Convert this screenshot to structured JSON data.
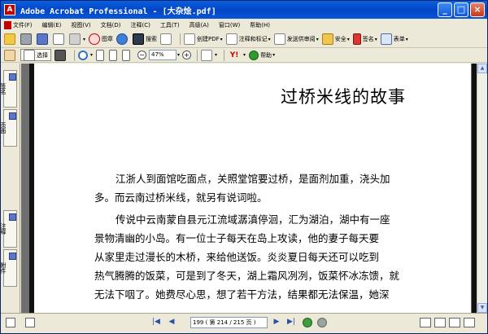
{
  "window": {
    "title": "Adobe Acrobat Professional - [大杂烩.pdf]",
    "app_icon": "acrobat-icon"
  },
  "menu": {
    "items": [
      "文件(F)",
      "编辑(E)",
      "视图(V)",
      "文档(D)",
      "注释(C)",
      "工具(T)",
      "高级(A)",
      "窗口(W)",
      "帮助(H)"
    ]
  },
  "toolbar1": {
    "stamp_label": "图章",
    "search_label": "搜索",
    "create_pdf_label": "创建PDF",
    "comment_label": "注释和标记",
    "review_label": "发送供审阅",
    "secure_label": "安全",
    "sign_label": "签名",
    "forms_label": "表单"
  },
  "toolbar2": {
    "select_label": "选择",
    "zoom_value": "47%",
    "help_label": "帮助"
  },
  "leftnav": {
    "tabs": [
      "签名",
      "页面",
      "注释",
      "附件"
    ]
  },
  "document": {
    "title": "过桥米线的故事",
    "paragraph1": [
      "江浙人到面馆吃面点，关照堂馆要过桥，是面剂加重，浇头加",
      "多。而云南过桥米线，就另有说词啦。"
    ],
    "paragraph2": [
      "传说中云南蒙自县元江流域潺滇停洄，汇为湖泊，湖中有一座",
      "景物清幽的小岛。有一位士子每天在岛上攻读，他的妻子每天要",
      "从家里走过漫长的木桥，来给他送饭。炎炎夏日每天还可以吃到",
      "热气腾腾的饭菜，可是到了冬天，湖上霜风冽冽，饭菜怀冰冻馈，就",
      "无法下咽了。她费尽心思，想了若干方法，结果都无法保温，她深"
    ]
  },
  "statusbar": {
    "page_display": "199 ( 第 214 / 215 页 )"
  }
}
